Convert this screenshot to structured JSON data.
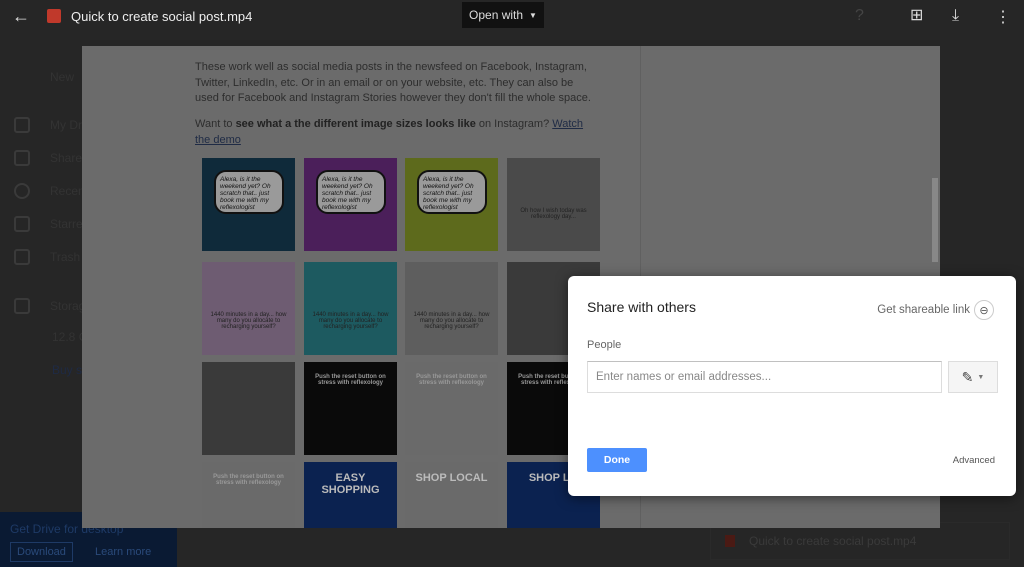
{
  "viewer": {
    "file_title": "Quick to create social post.mp4",
    "open_with_label": "Open with",
    "icons": [
      "back-arrow-icon",
      "video-file-icon",
      "add-comment-icon",
      "download-icon",
      "more-vert-icon",
      "help-icon",
      "settings-icon"
    ]
  },
  "drive": {
    "sidebar": {
      "new_label": "New",
      "items": [
        {
          "label": "My Drive"
        },
        {
          "label": "Shared"
        },
        {
          "label": "Recent"
        },
        {
          "label": "Starred"
        },
        {
          "label": "Trash"
        },
        {
          "label": "Storage"
        }
      ],
      "storage_text": "12.8 G",
      "buy_label": "Buy s"
    },
    "promo": {
      "text": "Get Drive for desktop",
      "download_label": "Download",
      "learn_more_label": "Learn more"
    },
    "upload_item": "Quick to create social post.mp4"
  },
  "document": {
    "paragraph1": "These work well as social media posts in the newsfeed on Facebook, Instagram, Twitter, LinkedIn, etc. Or in an email or on your website, etc. They can also be used for Facebook and Instagram Stories however they don't fill the whole space.",
    "para2_prefix": "Want to ",
    "para2_bold": "see what a the different image sizes looks like",
    "para2_mid": " on Instagram? ",
    "para2_link": "Watch the demo",
    "tiles": [
      {
        "text": "Alexa, is it the weekend yet? Oh scratch that.. just book me with my reflexologist",
        "bg": "#0f2a3a"
      },
      {
        "text": "Alexa, is it the weekend yet? Oh scratch that.. just book me with my reflexologist",
        "bg": "#4b1f5a"
      },
      {
        "text": "Alexa, is it the weekend yet? Oh scratch that.. just book me with my reflexologist",
        "bg": "#5d6a1c"
      },
      {
        "text": "Oh how I wish today was reflexology day...",
        "bg": "#4a4a4a"
      },
      {
        "text": "1440 minutes in a day... how many do you allocate to recharging yourself?",
        "bg": "#6e5c72"
      },
      {
        "text": "1440 minutes in a day... how many do you allocate to recharging yourself?",
        "bg": "#1d5a60"
      },
      {
        "text": "1440 minutes in a day... how many do you allocate to recharging yourself?",
        "bg": "#5e5e5e"
      },
      {
        "text": "",
        "bg": "#3a3a3a"
      },
      {
        "text": "",
        "bg": "#3a3a3a"
      },
      {
        "text": "Push the reset button on stress with reflexology",
        "bg": "#0a0a0a"
      },
      {
        "text": "Push the reset button on stress with reflexology",
        "bg": "#6a6a6a"
      },
      {
        "text": "Push the reset button on stress with reflexology",
        "bg": "#0a0a0a"
      },
      {
        "text": "Push the reset button on stress with reflexology",
        "bg": "#6a6a6a"
      },
      {
        "text": "EASY SHOPPING",
        "bg": "#0b2250"
      },
      {
        "text": "SHOP LOCAL",
        "bg": "#6a6a6a"
      },
      {
        "text": "SHOP LO",
        "bg": "#0b2250"
      }
    ]
  },
  "share_dialog": {
    "title": "Share with others",
    "shareable_link_label": "Get shareable link",
    "people_label": "People",
    "input_placeholder": "Enter names or email addresses...",
    "input_value": "",
    "permission_icon": "pencil-icon",
    "done_label": "Done",
    "advanced_label": "Advanced",
    "accent": "#4d90fe"
  }
}
